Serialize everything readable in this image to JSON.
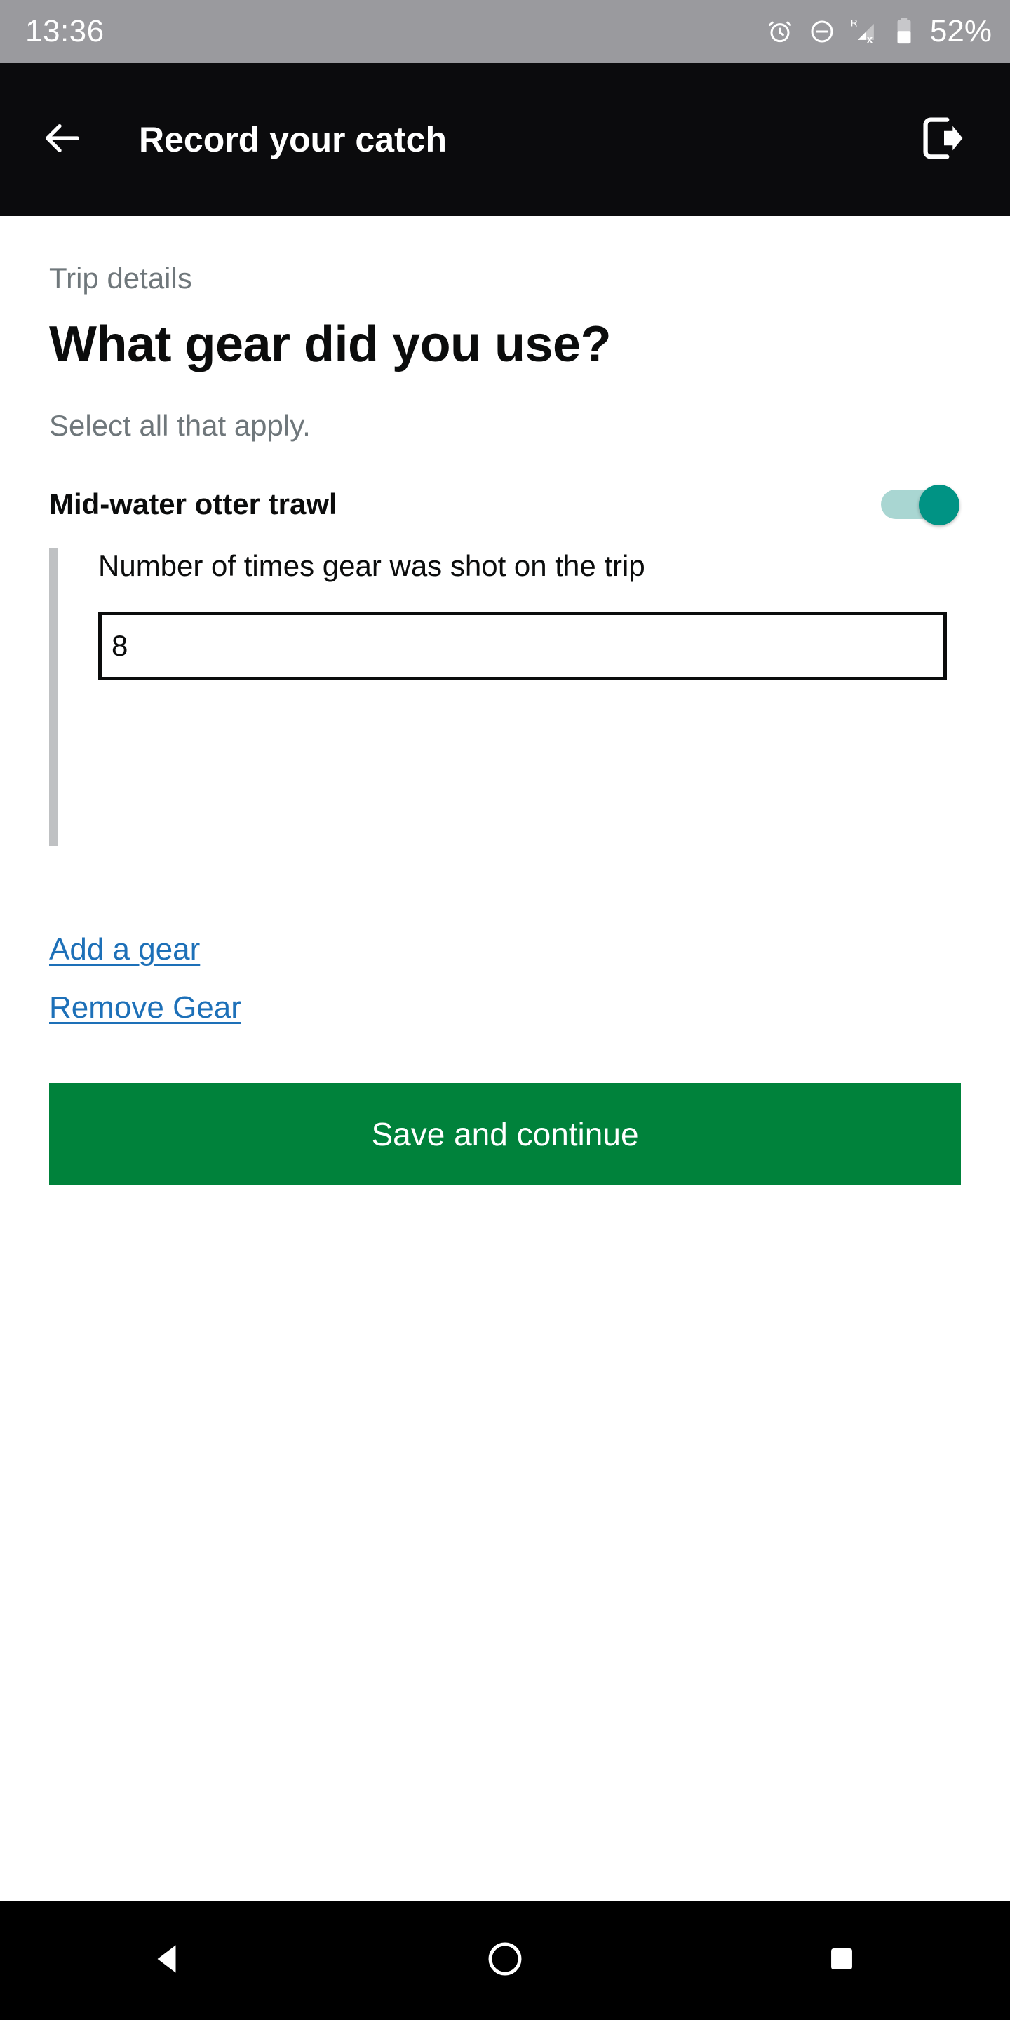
{
  "status_bar": {
    "time": "13:36",
    "battery_percent": "52%",
    "icons": [
      "alarm-clock-icon",
      "do-not-disturb-icon",
      "signal-roaming-no-service-icon",
      "battery-icon"
    ],
    "background_color": "#9a9a9e",
    "text_color": "#ffffff"
  },
  "app_bar": {
    "title": "Record your catch",
    "back_icon": "arrow-left-icon",
    "exit_icon": "sign-out-icon",
    "background_color": "#0b0b0d"
  },
  "main": {
    "caption": "Trip details",
    "heading": "What gear did you use?",
    "hint": "Select all that apply.",
    "gear": {
      "label": "Mid-water otter trawl",
      "toggle_state": "on",
      "toggle_track_color": "#a9d6d2",
      "toggle_thumb_color": "#009384"
    },
    "conditional": {
      "field_label": "Number of times gear was shot on the trip",
      "input_value": "8",
      "input_placeholder": ""
    },
    "links": [
      {
        "label": "Add a gear",
        "name": "add-a-gear-link"
      },
      {
        "label": "Remove Gear",
        "name": "remove-gear-link"
      }
    ],
    "link_color": "#1d70b8",
    "primary_button": {
      "label": "Save and continue",
      "color": "#00823b"
    }
  },
  "nav_bar": {
    "back_icon": "triangle-back-icon",
    "home_icon": "circle-home-icon",
    "recents_icon": "square-recents-icon",
    "background_color": "#000000"
  }
}
